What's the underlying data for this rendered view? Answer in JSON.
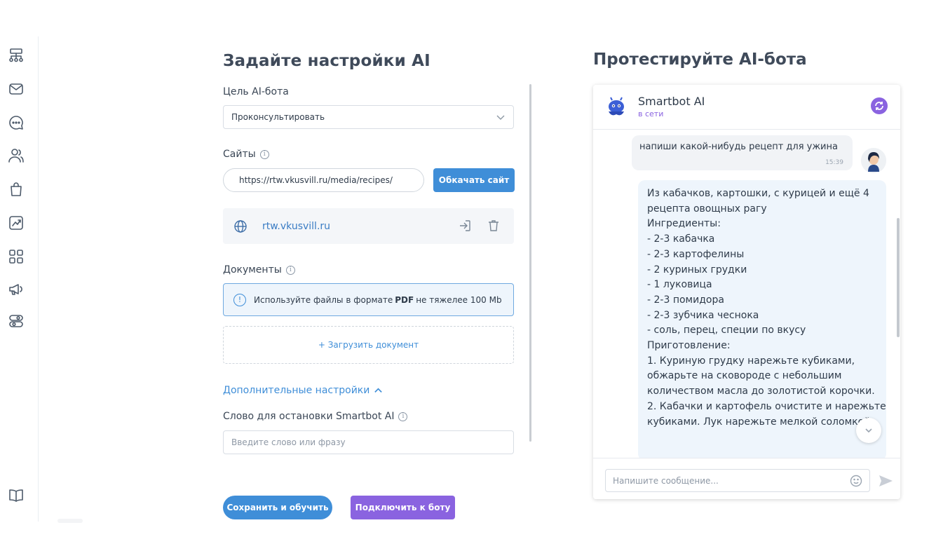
{
  "sidebar": {
    "icons": [
      "sitemap-icon",
      "mail-icon",
      "chat-bubble-icon",
      "users-icon",
      "shopping-bag-icon",
      "chart-icon",
      "grid-icon",
      "megaphone-icon",
      "toggles-icon",
      "book-icon"
    ]
  },
  "settings": {
    "title": "Задайте настройки AI",
    "goal_label": "Цель AI-бота",
    "goal_value": "Проконсультировать",
    "sites_label": "Сайты",
    "site_url_value": "https://rtw.vkusvill.ru/media/recipes/",
    "crawl_button": "Обкачать сайт",
    "site_item": "rtw.vkusvill.ru",
    "documents_label": "Документы",
    "notice_prefix": "Используйте файлы в формате",
    "notice_bold": "PDF",
    "notice_suffix": "не тяжелее 100 Mb",
    "upload_label": "+ Загрузить документ",
    "advanced_label": "Дополнительные настройки",
    "stop_word_label": "Слово для остановки Smartbot AI",
    "stop_word_placeholder": "Введите слово или фразу",
    "save_button": "Сохранить и обучить",
    "connect_button": "Подключить к боту"
  },
  "chat": {
    "title": "Протестируйте AI-бота",
    "bot_name": "Smartbot AI",
    "bot_status": "в сети",
    "user_message": "напиши какой-нибудь рецепт для ужина",
    "user_time": "15:39",
    "bot_lines": [
      "Из кабачков, картошки, с курицей и ещё 4",
      "рецепта овощных рагу",
      "",
      "Ингредиенты:",
      "- 2-3 кабачка",
      "- 2-3 картофелины",
      "- 2 куриных грудки",
      "- 1 луковица",
      "- 2-3 помидора",
      "- 2-3 зубчика чеснока",
      "- соль, перец, специи по вкусу",
      "",
      "Приготовление:",
      "1. Куриную грудку нарежьте кубиками,",
      "обжарьте на сковороде с небольшим",
      "количеством масла до золотистой корочки.",
      "2. Кабачки и картофель очистите и нарежьте",
      "кубиками. Лук нарежьте мелкой соломкой."
    ],
    "input_placeholder": "Напишите сообщение..."
  }
}
